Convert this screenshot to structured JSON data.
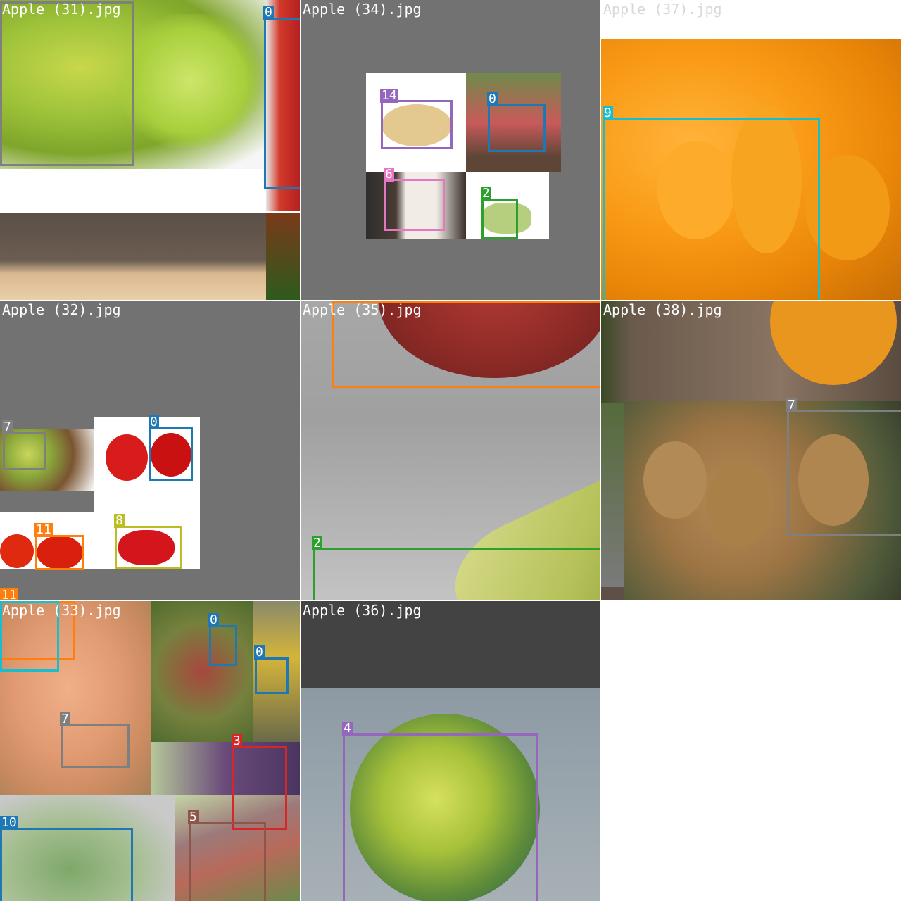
{
  "tiles": [
    {
      "title": "Apple (31).jpg"
    },
    {
      "title": "Apple (34).jpg"
    },
    {
      "title": "Apple (37).jpg"
    },
    {
      "title": "Apple (32).jpg"
    },
    {
      "title": "Apple (35).jpg"
    },
    {
      "title": "Apple (38).jpg"
    },
    {
      "title": "Apple (33).jpg"
    },
    {
      "title": "Apple (36).jpg"
    }
  ],
  "labels": {
    "c0": "0",
    "c2": "2",
    "c3": "3",
    "c4": "4",
    "c5": "5",
    "c6": "6",
    "c7": "7",
    "c8": "8",
    "c9": "9",
    "c10": "10",
    "c11": "11",
    "c14": "14"
  },
  "class_colors": {
    "c0": "#1f77b4",
    "c2": "#2ca02c",
    "c3": "#d62728",
    "c4": "#9467bd",
    "c5": "#8c564b",
    "c6": "#e377c2",
    "c7": "#7f7f7f",
    "c8": "#bcbd22",
    "c9": "#17becf",
    "c10": "#1f77b4",
    "c11": "#ff7f0e",
    "c14": "#9467bd"
  }
}
